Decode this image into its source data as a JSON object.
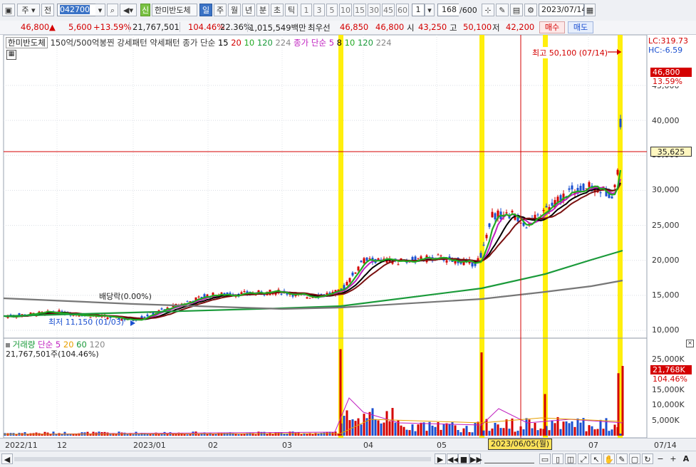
{
  "toolbar": {
    "period_select": "주",
    "prev_label": "전",
    "stock_code": "042700",
    "new_badge": "신",
    "stock_name": "한미반도체",
    "period_tabs": [
      "일",
      "주",
      "월",
      "년",
      "분",
      "초",
      "틱"
    ],
    "interval_buttons": [
      "1",
      "3",
      "5",
      "10",
      "15",
      "30",
      "45",
      "60"
    ],
    "interval_value": "1",
    "count_current": "168",
    "count_total": "/600",
    "date_value": "2023/07/14"
  },
  "quote": {
    "price": "46,800",
    "arrow": "▲",
    "change": "5,600",
    "change_pct": "+13.59%",
    "volume": "21,767,501",
    "volume_pct": "104.46%",
    "turnover": "22.36%",
    "amount": "1,015,549백만",
    "best_bid_label": "최우선",
    "best_ask": "46,850",
    "best_bid": "46,800",
    "open_label": "시",
    "open": "43,250",
    "high_label": "고",
    "high": "50,100",
    "low_label": "저",
    "low": "42,200",
    "buy_label": "매수",
    "sell_label": "매도"
  },
  "price_panel": {
    "legend_name": "한미반도체",
    "legend_items": [
      "150억/500억봉찐",
      "강세패턴",
      "약세패턴"
    ],
    "ma_label": "종가 단순",
    "ma_periods": [
      "15",
      "20",
      "10",
      "120",
      "224"
    ],
    "ma2_label": "종가 단순",
    "ma2_periods": [
      "5",
      "8",
      "10",
      "120",
      "224"
    ],
    "lc_label": "LC:319.73",
    "hc_label": "HC:-6.59",
    "high_annotation": "최고 50,100 (07/14)",
    "low_annotation": "최저 11,150 (01/03)",
    "dividend_annotation": "배당락(0.00%)",
    "price_tag": "46,800",
    "price_pct_tag": "13.59%",
    "cursor_tag": "35,625",
    "y_ticks": [
      "45,000",
      "40,000",
      "35,000",
      "30,000",
      "25,000",
      "20,000",
      "15,000",
      "10,000"
    ]
  },
  "volume_panel": {
    "legend_name": "거래량",
    "ma_label": "단순",
    "ma_periods": [
      "5",
      "20",
      "60",
      "120"
    ],
    "value_line": "21,767,501주(104.46%)",
    "volume_tag": "21,768K",
    "volume_pct_tag": "104.46%",
    "y_ticks": [
      "25,000K",
      "20,000K",
      "15,000K",
      "10,000K",
      "5,000K"
    ]
  },
  "x_axis": {
    "labels": [
      "2022/11",
      "12",
      "2023/01",
      "02",
      "03",
      "04",
      "05",
      "07",
      "07/14"
    ],
    "cursor_date": "2023/06/05(월)"
  },
  "colors": {
    "up": "#d40000",
    "down": "#1a4fd0",
    "ma5": "#c020c0",
    "ma8": "#000000",
    "ma10": "#22aa22",
    "ma120": "#1a9a3a",
    "ma224": "#777777",
    "highlight": "#ffee00"
  },
  "chart_data": {
    "type": "candlestick",
    "unit": "KRW",
    "price_range": [
      10000,
      50000
    ],
    "volume_range_k": [
      0,
      28000
    ],
    "monthly_points": [
      {
        "x": "2022/11",
        "close": 12000
      },
      {
        "x": "2022/12",
        "close": 12600
      },
      {
        "x": "2023/01",
        "close": 12400
      },
      {
        "x": "2023/02",
        "close": 15200
      },
      {
        "x": "2023/03",
        "close": 15200
      },
      {
        "x": "2023/04",
        "close": 20000
      },
      {
        "x": "2023/05",
        "close": 20200
      },
      {
        "x": "2023/06",
        "close": 27000
      },
      {
        "x": "2023/07",
        "close": 30000
      },
      {
        "x": "2023/07/14",
        "close": 46800
      }
    ],
    "period_high": {
      "date": "07/14",
      "value": 50100
    },
    "period_low": {
      "date": "01/03",
      "value": 11150
    }
  }
}
